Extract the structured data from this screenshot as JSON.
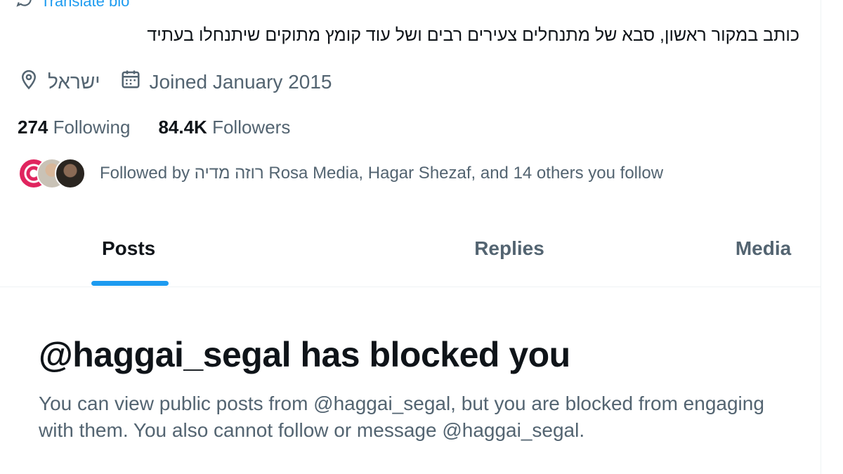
{
  "profile": {
    "translate_label": "Translate bio",
    "bio": "כותב במקור ראשון, סבא של מתנחלים צעירים רבים ושל עוד קומץ מתוקים שיתנחלו בעתיד",
    "location": "ישראל",
    "joined": "Joined January 2015",
    "following_count": "274",
    "following_label": "Following",
    "followers_count": "84.4K",
    "followers_label": "Followers",
    "followed_by": "Followed by רוזה מדיה Rosa Media, Hagar Shezaf, and 14 others you follow"
  },
  "tabs": [
    {
      "label": "Posts",
      "active": true
    },
    {
      "label": "Replies",
      "active": false
    },
    {
      "label": "Media",
      "active": false
    }
  ],
  "blocked": {
    "title": "@haggai_segal has blocked you",
    "body": "You can view public posts from @haggai_segal, but you are blocked from engaging with them. You also cannot follow or message @haggai_segal."
  },
  "colors": {
    "accent": "#1d9bf0",
    "secondary_text": "#536471",
    "primary_text": "#0f1419"
  },
  "icons": {
    "translate": "translate-icon",
    "location": "location-pin-icon",
    "calendar": "calendar-icon"
  }
}
